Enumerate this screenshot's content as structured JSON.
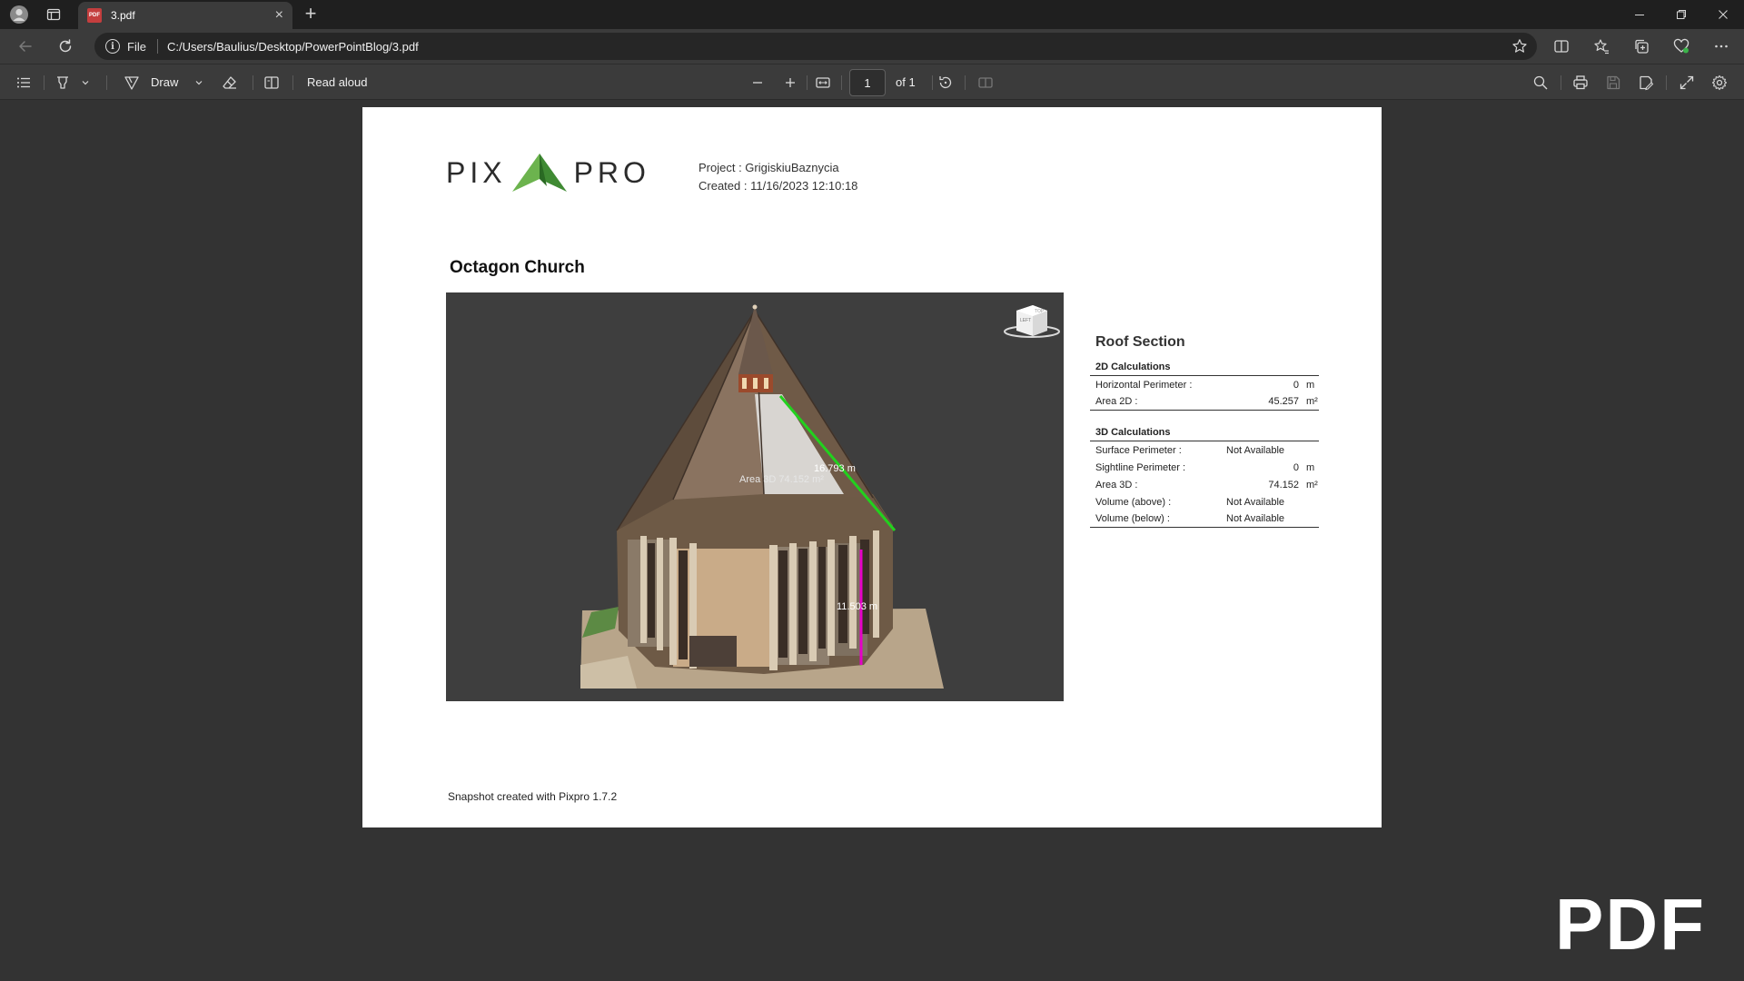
{
  "browser": {
    "tab_title": "3.pdf",
    "tab_close": "×",
    "new_tab": "+",
    "address_scheme": "File",
    "address_url": "C:/Users/Baulius/Desktop/PowerPointBlog/3.pdf"
  },
  "toolbar": {
    "draw_label": "Draw",
    "read_aloud_label": "Read aloud",
    "page_current": "1",
    "page_total": "of 1"
  },
  "document": {
    "logo_left": "PIX",
    "logo_right": "PRO",
    "project_line": "Project : GrigiskiuBaznycia",
    "created_line": "Created : 11/16/2023 12:10:18",
    "title": "Octagon Church",
    "measure_slope": "16.793 m",
    "measure_area": "Area 3D 74.152 m²",
    "measure_height": "11.503 m",
    "viewcube_top": "TOP",
    "viewcube_left": "LEFT",
    "section_title": "Roof Section",
    "calc_2d_title": "2D Calculations",
    "calc_2d": [
      {
        "label": "Horizontal Perimeter :",
        "value": "0",
        "unit": "m"
      },
      {
        "label": "Area 2D :",
        "value": "45.257",
        "unit": "m²"
      }
    ],
    "calc_3d_title": "3D Calculations",
    "calc_3d": [
      {
        "label": "Surface Perimeter :",
        "value": "Not Available",
        "unit": ""
      },
      {
        "label": "Sightline Perimeter :",
        "value": "0",
        "unit": "m"
      },
      {
        "label": "Area 3D :",
        "value": "74.152",
        "unit": "m²"
      },
      {
        "label": "Volume (above) :",
        "value": "Not Available",
        "unit": ""
      },
      {
        "label": "Volume (below) :",
        "value": "Not Available",
        "unit": ""
      }
    ],
    "footer": "Snapshot created with Pixpro 1.7.2"
  },
  "watermark": "PDF",
  "colors": {
    "measure_green": "#22d11e",
    "measure_magenta": "#e600c8",
    "logo_green": "#4a9b3a"
  }
}
